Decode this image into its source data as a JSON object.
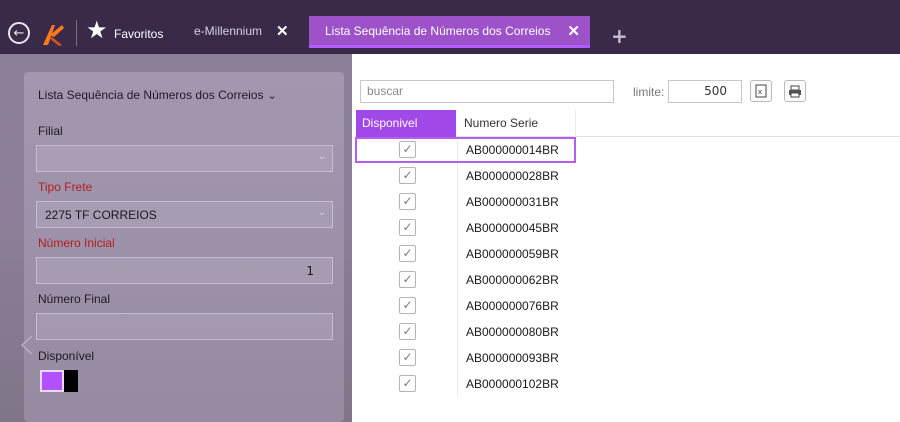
{
  "topbar": {
    "favorites_label": "Favoritos",
    "tabs": [
      {
        "label": "e-Millennium",
        "close": "✕"
      },
      {
        "label": "Lista Sequência de Números dos Correios",
        "close": "✕",
        "active": true
      }
    ],
    "add_tab": "+"
  },
  "filter_panel": {
    "title": "Lista Sequência de Números dos Correios",
    "filial": {
      "label": "Filial",
      "value": ""
    },
    "tipo_frete": {
      "label": "Tipo Frete",
      "value": "2275 TF CORREIOS"
    },
    "numero_inicial": {
      "label": "Número Inicial",
      "value": "1"
    },
    "numero_final": {
      "label": "Número Final",
      "value": ""
    },
    "disponivel": {
      "label": "Disponível",
      "checked": true
    }
  },
  "toolbar": {
    "search_placeholder": "buscar",
    "limite_label": "limite:",
    "limite_value": "500"
  },
  "grid": {
    "columns": [
      "Disponivel",
      "Numero Serie"
    ],
    "rows": [
      {
        "disponivel": true,
        "serie": "AB000000014BR"
      },
      {
        "disponivel": true,
        "serie": "AB000000028BR"
      },
      {
        "disponivel": true,
        "serie": "AB000000031BR"
      },
      {
        "disponivel": true,
        "serie": "AB000000045BR"
      },
      {
        "disponivel": true,
        "serie": "AB000000059BR"
      },
      {
        "disponivel": true,
        "serie": "AB000000062BR"
      },
      {
        "disponivel": true,
        "serie": "AB000000076BR"
      },
      {
        "disponivel": true,
        "serie": "AB000000080BR"
      },
      {
        "disponivel": true,
        "serie": "AB000000093BR"
      },
      {
        "disponivel": true,
        "serie": "AB000000102BR"
      }
    ]
  },
  "colors": {
    "accent": "#a049e8",
    "topbar": "#3a2a4a",
    "active_tab": "#9d52c9",
    "required_label": "#b21e1e"
  }
}
